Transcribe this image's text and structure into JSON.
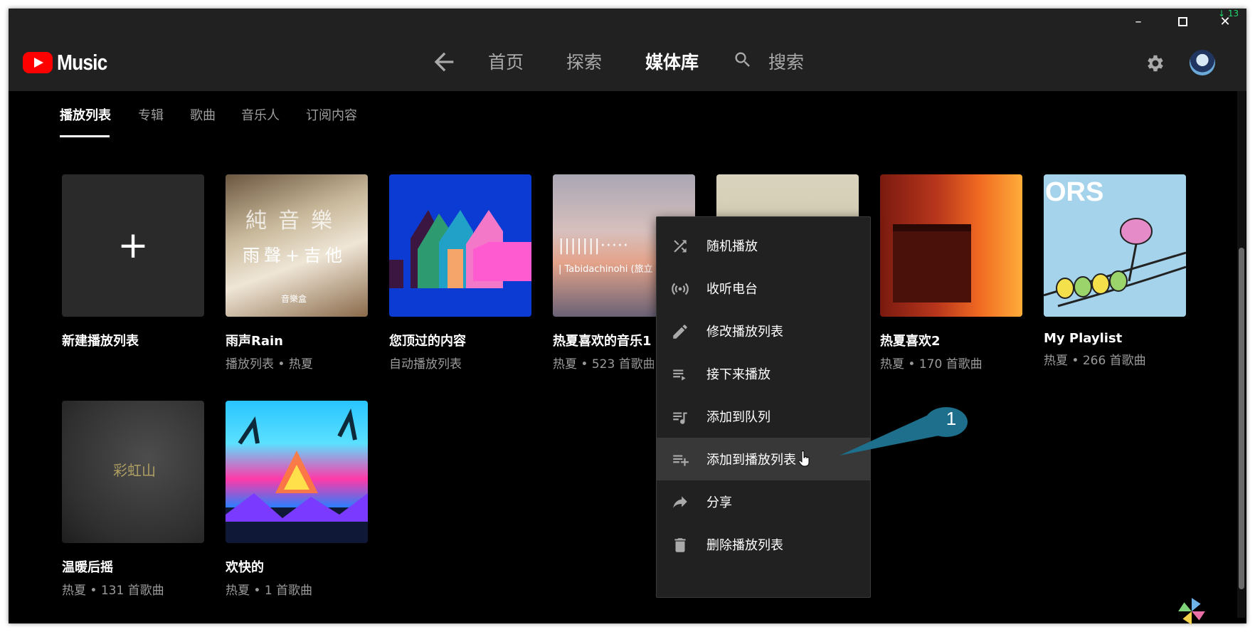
{
  "window": {
    "controls": {
      "minimize": "–",
      "maximize": "□",
      "close": "✕"
    },
    "tray_badge": "↓ 13"
  },
  "app": {
    "logo_text": "Music",
    "brand_color": "#ff0000"
  },
  "nav": {
    "back_icon": "arrow-left-icon",
    "items": [
      {
        "label": "首页",
        "active": false
      },
      {
        "label": "探索",
        "active": false
      },
      {
        "label": "媒体库",
        "active": true
      },
      {
        "label": "搜索",
        "active": false
      }
    ],
    "settings_icon": "gear-icon",
    "avatar_icon": "avatar"
  },
  "tabs": [
    {
      "label": "播放列表",
      "active": true
    },
    {
      "label": "专辑",
      "active": false
    },
    {
      "label": "歌曲",
      "active": false
    },
    {
      "label": "音乐人",
      "active": false
    },
    {
      "label": "订阅内容",
      "active": false
    }
  ],
  "playlists": [
    {
      "title": "新建播放列表",
      "subtitle": ""
    },
    {
      "title": "雨声Rain",
      "subtitle": "播放列表 • 热夏",
      "art_text": [
        "純音樂",
        "雨聲+吉他",
        "音樂盒"
      ]
    },
    {
      "title": "您顶过的内容",
      "subtitle": "自动播放列表"
    },
    {
      "title": "热夏喜欢的音乐1",
      "subtitle": "热夏 • 523 首歌曲",
      "art_text": [
        "|||||||·····",
        "| Tabidachinohi (旅立"
      ]
    },
    {
      "title": "",
      "subtitle": ""
    },
    {
      "title": "热夏喜欢2",
      "subtitle": "热夏 • 170 首歌曲"
    },
    {
      "title": "My Playlist",
      "subtitle": "热夏 • 266 首歌曲",
      "art_text": [
        "ORS"
      ]
    },
    {
      "title": "温暖后摇",
      "subtitle": "热夏 • 131 首歌曲",
      "art_text": [
        "彩虹山"
      ]
    },
    {
      "title": "欢快的",
      "subtitle": "热夏 • 1 首歌曲"
    }
  ],
  "context_menu": {
    "items": [
      {
        "label": "随机播放",
        "icon": "shuffle-icon"
      },
      {
        "label": "收听电台",
        "icon": "radio-icon"
      },
      {
        "label": "修改播放列表",
        "icon": "pencil-icon"
      },
      {
        "label": "接下来播放",
        "icon": "play-next-icon"
      },
      {
        "label": "添加到队列",
        "icon": "add-to-queue-icon"
      },
      {
        "label": "添加到播放列表",
        "icon": "playlist-add-icon",
        "hover": true
      },
      {
        "label": "分享",
        "icon": "share-icon"
      },
      {
        "label": "删除播放列表",
        "icon": "trash-icon"
      }
    ]
  },
  "callout": {
    "number": "1",
    "color": "#1d6f8c"
  }
}
